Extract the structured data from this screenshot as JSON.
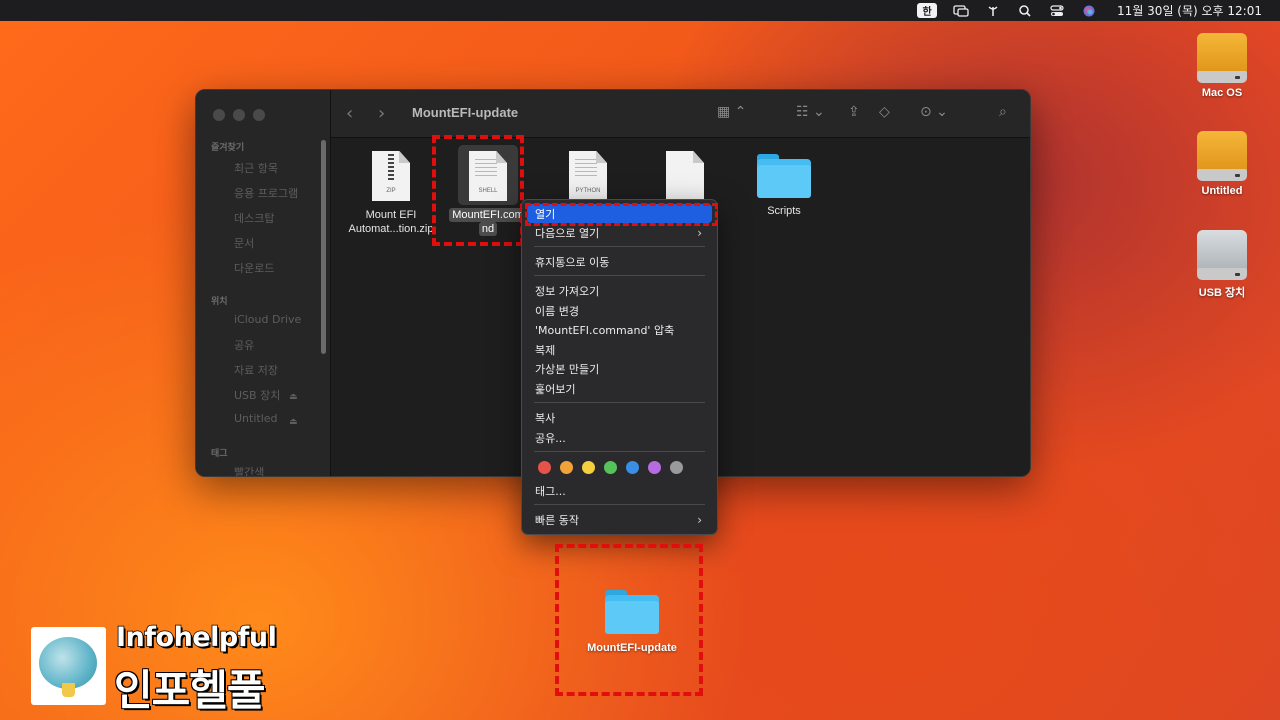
{
  "menubar": {
    "ime": "한",
    "clock": "11월 30일 (목) 오후 12:01",
    "icons": [
      "screen-mirroring-icon",
      "antenna-icon",
      "search-icon",
      "control-center-icon",
      "siri-icon"
    ]
  },
  "finder": {
    "title": "MountEFI-update",
    "sidebar": {
      "favorites_header": "즐겨찾기",
      "favorites": [
        "최근 항목",
        "응용 프로그램",
        "데스크탑",
        "문서",
        "다운로드"
      ],
      "locations_header": "위치",
      "locations": [
        "iCloud Drive",
        "공유",
        "자료 저장",
        "USB 장치",
        "Untitled"
      ],
      "tags_header": "태그",
      "tags": [
        "빨간색"
      ]
    },
    "files": [
      {
        "name": "Mount EFI Automat...tion.zip",
        "kind": "ZIP"
      },
      {
        "name": "MountEFI.command",
        "kind": "SHELL"
      },
      {
        "name": "",
        "kind": "PYTHON"
      },
      {
        "name": "",
        "kind": ""
      },
      {
        "name": "Scripts",
        "kind": "folder"
      }
    ],
    "selected_label_line1": "MountEFI.com",
    "selected_label_line2": "nd",
    "zip_line1": "Mount EFI",
    "zip_line2": "Automat...tion.zip"
  },
  "context_menu": {
    "open": "열기",
    "open_with": "다음으로 열기",
    "trash": "휴지통으로 이동",
    "get_info": "정보 가져오기",
    "rename": "이름 변경",
    "compress": "'MountEFI.command' 압축",
    "duplicate": "복제",
    "make_alias": "가상본 만들기",
    "quick_look": "훑어보기",
    "copy": "복사",
    "share": "공유...",
    "tag_colors": [
      "#e5534b",
      "#f1a33a",
      "#f4d03f",
      "#55c35a",
      "#3a8ee6",
      "#b66be0",
      "#9a9a9a"
    ],
    "tags": "태그...",
    "quick_actions": "빠른 동작"
  },
  "desktop": {
    "drives": [
      {
        "label": "Mac OS",
        "color": "#f0a21c"
      },
      {
        "label": "Untitled",
        "color": "#f0a21c"
      },
      {
        "label": "USB 장치",
        "color": "#bfc4c8"
      }
    ],
    "folder_label": "MountEFI-update"
  },
  "watermark": {
    "line1": "Infohelpful",
    "line2": "인포헬풀"
  },
  "colors": {
    "highlight": "#e10e0e",
    "menu_active": "#1d5fe0",
    "folder": "#45bdf2"
  }
}
